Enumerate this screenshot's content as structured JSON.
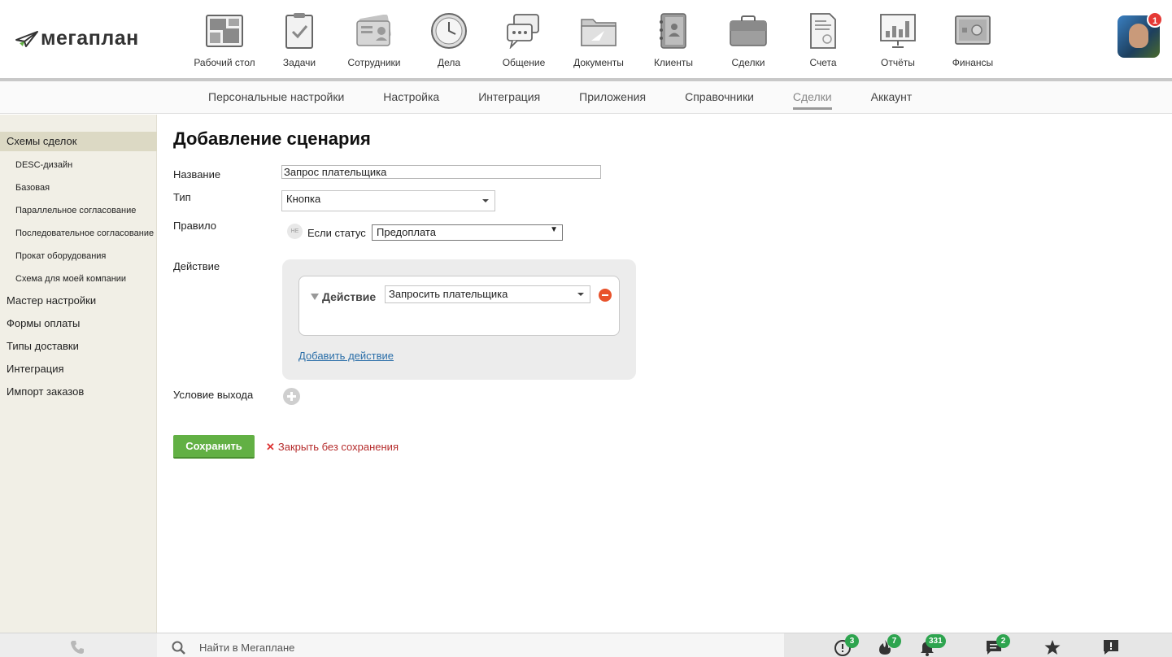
{
  "app": {
    "logo_text": "мегаплан",
    "profile_badge": "1"
  },
  "modules": [
    {
      "label": "Рабочий стол",
      "icon": "desktop-icon"
    },
    {
      "label": "Задачи",
      "icon": "tasks-icon"
    },
    {
      "label": "Сотрудники",
      "icon": "employees-icon"
    },
    {
      "label": "Дела",
      "icon": "clock-icon"
    },
    {
      "label": "Общение",
      "icon": "chat-icon"
    },
    {
      "label": "Документы",
      "icon": "folder-icon"
    },
    {
      "label": "Клиенты",
      "icon": "contacts-book-icon"
    },
    {
      "label": "Сделки",
      "icon": "briefcase-icon"
    },
    {
      "label": "Счета",
      "icon": "invoice-icon"
    },
    {
      "label": "Отчёты",
      "icon": "report-chart-icon"
    },
    {
      "label": "Финансы",
      "icon": "safe-icon"
    }
  ],
  "subnav": [
    {
      "label": "Персональные настройки",
      "active": false
    },
    {
      "label": "Настройка",
      "active": false
    },
    {
      "label": "Интеграция",
      "active": false
    },
    {
      "label": "Приложения",
      "active": false
    },
    {
      "label": "Справочники",
      "active": false
    },
    {
      "label": "Сделки",
      "active": true
    },
    {
      "label": "Аккаунт",
      "active": false
    }
  ],
  "sidebar": {
    "schemes_label": "Схемы сделок",
    "sub_items": [
      "DESC-дизайн",
      "Базовая",
      "Параллельное согласование",
      "Последовательное согласование",
      "Прокат оборудования",
      "Схема для моей компании"
    ],
    "wizard": "Мастер настройки",
    "payment_forms": "Формы оплаты",
    "delivery_types": "Типы доставки",
    "integration": "Интеграция",
    "import_orders": "Импорт заказов"
  },
  "form": {
    "title": "Добавление сценария",
    "name_label": "Название",
    "name_value": "Запрос плательщика",
    "type_label": "Тип",
    "type_value": "Кнопка",
    "rule_label": "Правило",
    "not_toggle": "НЕ",
    "if_status": "Если статус",
    "status_value": "Предоплата",
    "action_label": "Действие",
    "action_card_label": "Действие",
    "action_value": "Запросить плательщика",
    "add_action": "Добавить действие",
    "exit_condition_label": "Условие выхода",
    "save": "Сохранить",
    "close_without_save": "Закрыть без сохранения"
  },
  "bottombar": {
    "search_placeholder": "Найти в Мегаплане",
    "badges": {
      "alerts": "3",
      "hot": "7",
      "notifications": "331",
      "messages": "2"
    }
  },
  "colors": {
    "primary_green": "#62b044",
    "badge_green": "#2ea44f",
    "sidebar_bg": "#f1efe6",
    "remove_red": "#e8522b",
    "link_blue": "#2a6ea8"
  }
}
